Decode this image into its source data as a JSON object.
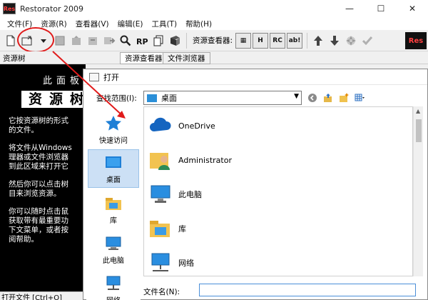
{
  "window": {
    "title": "Restorator 2009",
    "app_icon_text": "Res",
    "minimize": "—",
    "maximize": "☐",
    "close": "✕"
  },
  "menu": [
    "文件(F)",
    "资源(R)",
    "查看器(V)",
    "编辑(E)",
    "工具(T)",
    "帮助(H)"
  ],
  "toolbar": {
    "viewer_label": "资源查看器:",
    "rc_label": "RC",
    "rp_label": "RP",
    "dark_icons": [
      "▦",
      "H",
      "RC",
      "ab!"
    ],
    "logo_text": "Res"
  },
  "panels": {
    "tree_title": "资源树",
    "tab_viewer": "资源查看器",
    "tab_browser": "文件浏览器"
  },
  "tree_panel": {
    "heading": "此面板关",
    "banner": "资源树",
    "paragraphs": [
      "它按资源树的形式\n的文件。",
      "将文件从Windows\n理器或文件浏览器\n到此区域来打开它",
      "然后你可以点击树\n目来浏览资源。",
      "你可以随时点击鼠\n获取带有最重要功\n下文菜单，或者按\n阅帮助。"
    ]
  },
  "status": {
    "text": "打开文件 [Ctrl+O]"
  },
  "dialog": {
    "title": "打开",
    "look_in_label": "查找范围(I):",
    "look_in_value": "桌面",
    "places": [
      {
        "label": "快速访问",
        "icon": "star-icon"
      },
      {
        "label": "桌面",
        "icon": "desktop-icon"
      },
      {
        "label": "库",
        "icon": "library-icon"
      },
      {
        "label": "此电脑",
        "icon": "computer-icon"
      },
      {
        "label": "网络",
        "icon": "network-icon"
      }
    ],
    "files": [
      {
        "name": "OneDrive",
        "icon": "cloud-icon"
      },
      {
        "name": "Administrator",
        "icon": "user-folder-icon"
      },
      {
        "name": "此电脑",
        "icon": "computer-icon"
      },
      {
        "name": "库",
        "icon": "library-icon"
      },
      {
        "name": "网络",
        "icon": "network-icon"
      }
    ],
    "filename_label": "文件名(N):",
    "filename_value": ""
  },
  "colors": {
    "accent_red": "#e01b1b",
    "selection": "#cce0f5",
    "folder_blue": "#2b8fd8"
  }
}
